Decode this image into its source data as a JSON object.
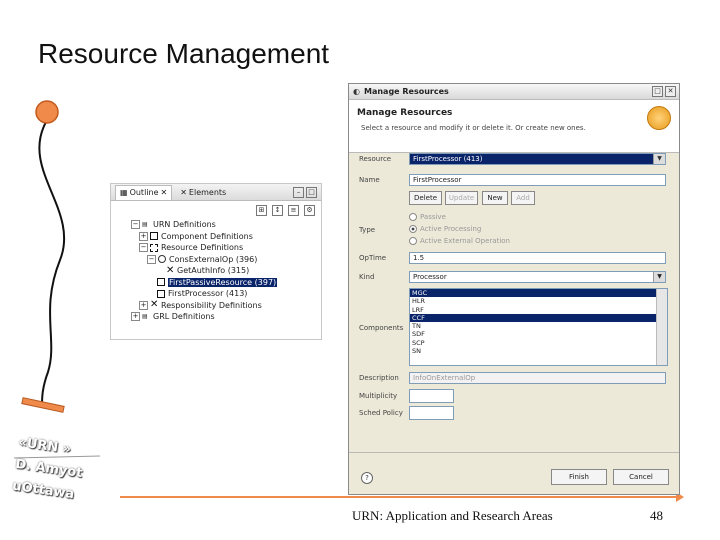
{
  "slide": {
    "title": "Resource Management",
    "footer": "URN: Application and Research Areas",
    "page_number": "48"
  },
  "stamp": {
    "line1": "«URN »",
    "line2": "D. Amyot",
    "line3": "uOttawa"
  },
  "outline": {
    "tabs": [
      {
        "label": "Outline",
        "icon": "outline-icon"
      },
      {
        "label": "Elements",
        "icon": "elements-icon"
      }
    ],
    "tree": [
      {
        "label": "URN Definitions",
        "twisty": "−",
        "icon": "urn-icon"
      },
      {
        "label": "Component Definitions",
        "twisty": "+",
        "icon": "square-icon"
      },
      {
        "label": "Resource Definitions",
        "twisty": "−",
        "icon": "resource-icon"
      },
      {
        "label": "ConsExternalOp (396)",
        "twisty": "−",
        "icon": "circle-icon"
      },
      {
        "label": "GetAuthInfo (315)",
        "twisty": "",
        "icon": "x-icon"
      },
      {
        "label": "FirstPassiveResource (397)",
        "twisty": "",
        "icon": "square-icon",
        "selected": true
      },
      {
        "label": "FirstProcessor (413)",
        "twisty": "",
        "icon": "square-icon"
      },
      {
        "label": "Responsibility Definitions",
        "twisty": "+",
        "icon": "x-icon"
      },
      {
        "label": "GRL Definitions",
        "twisty": "+",
        "icon": "grl-icon"
      }
    ]
  },
  "dialog": {
    "window_title": "Manage Resources",
    "heading": "Manage Resources",
    "description": "Select a resource and modify it or delete it. Or create new ones.",
    "labels": {
      "resource": "Resource",
      "name": "Name",
      "type": "Type",
      "optime": "OpTime",
      "kind": "Kind",
      "components": "Components",
      "description": "Description",
      "multiplicity": "Multiplicity",
      "sched_policy": "Sched Policy"
    },
    "resource_value": "FirstProcessor (413)",
    "name_value": "FirstProcessor",
    "buttons": {
      "delete": "Delete",
      "update": "Update",
      "new": "New",
      "add": "Add",
      "finish": "Finish",
      "cancel": "Cancel"
    },
    "type_options": [
      {
        "label": "Passive",
        "checked": false
      },
      {
        "label": "Active Processing",
        "checked": true
      },
      {
        "label": "Active External Operation",
        "checked": false
      }
    ],
    "optime_value": "1.5",
    "kind_value": "Processor",
    "components": [
      {
        "label": "MGC",
        "selected": true
      },
      {
        "label": "HLR",
        "selected": false
      },
      {
        "label": "LRF",
        "selected": false
      },
      {
        "label": "CCF",
        "selected": true
      },
      {
        "label": "TN",
        "selected": false
      },
      {
        "label": "SDF",
        "selected": false
      },
      {
        "label": "SCP",
        "selected": false
      },
      {
        "label": "SN",
        "selected": false
      }
    ],
    "description_value": "InfoOnExternalOp",
    "multiplicity_value": "",
    "sched_policy_value": ""
  }
}
